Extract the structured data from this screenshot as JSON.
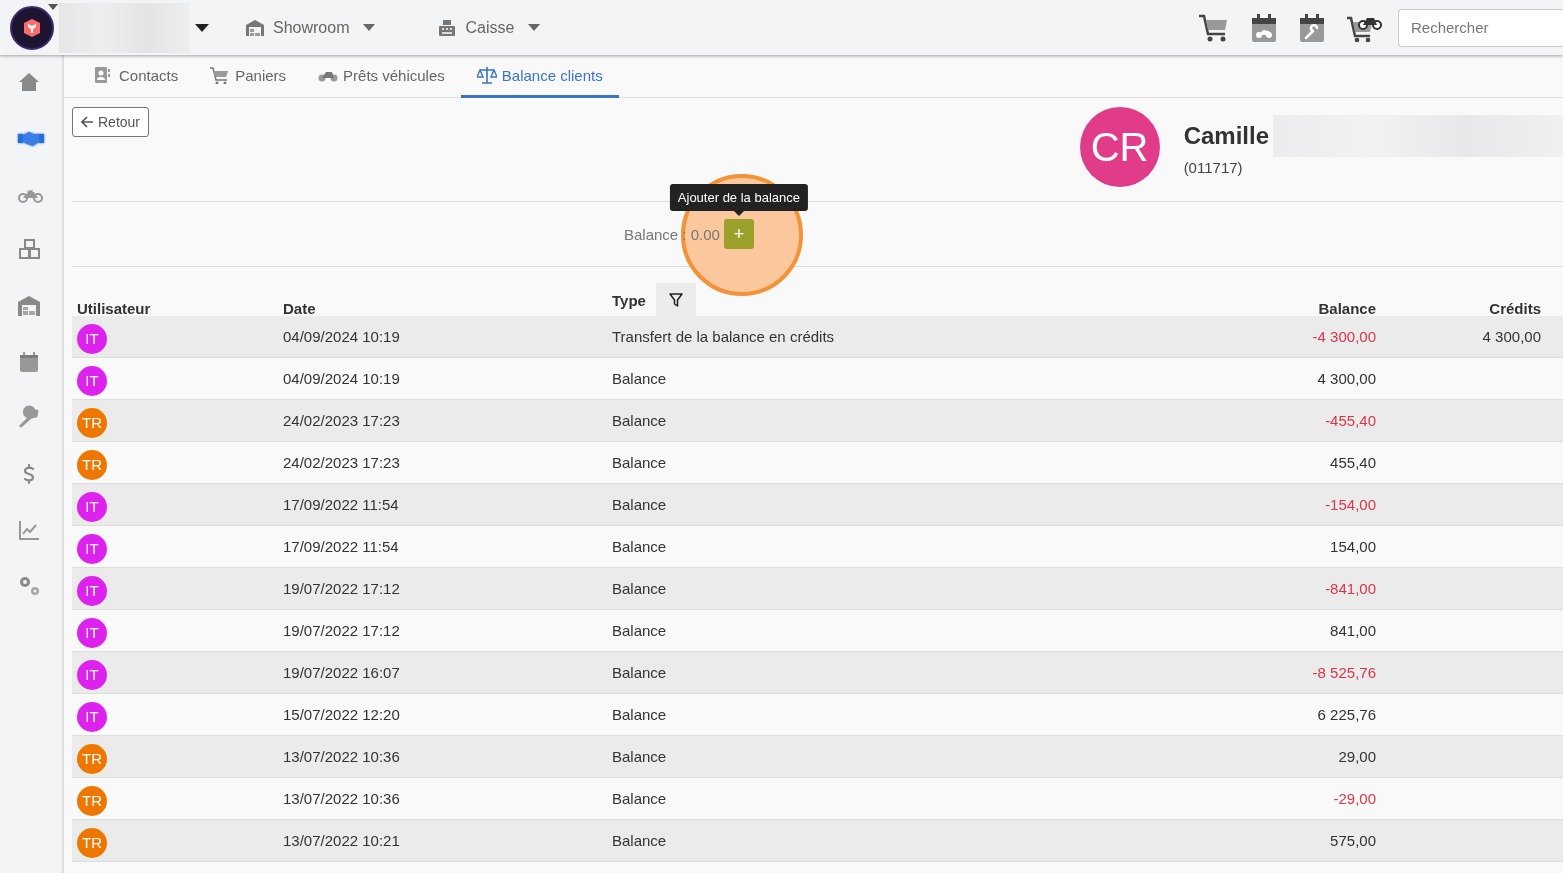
{
  "top_bar": {
    "menus": [
      {
        "label": "Showroom"
      },
      {
        "label": "Caisse"
      }
    ],
    "search": {
      "placeholder": "Rechercher"
    }
  },
  "sidebar": {
    "items": [
      {
        "selected": false
      },
      {
        "selected": true
      },
      {
        "selected": false
      },
      {
        "selected": false
      },
      {
        "selected": false
      },
      {
        "selected": false
      },
      {
        "selected": false
      },
      {
        "selected": false
      },
      {
        "selected": false
      },
      {
        "selected": false
      }
    ]
  },
  "tabs": [
    {
      "label": "Contacts",
      "selected": false
    },
    {
      "label": "Paniers",
      "selected": false
    },
    {
      "label": "Prêts véhicules",
      "selected": false
    },
    {
      "label": "Balance clients",
      "selected": true
    }
  ],
  "back_button": "Retour",
  "client": {
    "initials": "CR",
    "name": "Camille",
    "number": "(011717)"
  },
  "balance": {
    "label": "Balance : 0.00",
    "add_button": "+",
    "tooltip": "Ajouter de la balance"
  },
  "table": {
    "columns": [
      "Utilisateur",
      "Date",
      "Type",
      "Balance",
      "Crédits"
    ],
    "rows": [
      {
        "user": "IT",
        "color": "#dd22ee",
        "date": "04/09/2024 10:19",
        "type": "Transfert de la balance en crédits",
        "balance": "-4 300,00",
        "negative": true,
        "credits": "4 300,00"
      },
      {
        "user": "IT",
        "color": "#dd22ee",
        "date": "04/09/2024 10:19",
        "type": "Balance",
        "balance": "4 300,00",
        "negative": false
      },
      {
        "user": "TR",
        "color": "#ee7700",
        "date": "24/02/2023 17:23",
        "type": "Balance",
        "balance": "-455,40",
        "negative": true
      },
      {
        "user": "TR",
        "color": "#ee7700",
        "date": "24/02/2023 17:23",
        "type": "Balance",
        "balance": "455,40",
        "negative": false
      },
      {
        "user": "IT",
        "color": "#dd22ee",
        "date": "17/09/2022 11:54",
        "type": "Balance",
        "balance": "-154,00",
        "negative": true
      },
      {
        "user": "IT",
        "color": "#dd22ee",
        "date": "17/09/2022 11:54",
        "type": "Balance",
        "balance": "154,00",
        "negative": false
      },
      {
        "user": "IT",
        "color": "#dd22ee",
        "date": "19/07/2022 17:12",
        "type": "Balance",
        "balance": "-841,00",
        "negative": true
      },
      {
        "user": "IT",
        "color": "#dd22ee",
        "date": "19/07/2022 17:12",
        "type": "Balance",
        "balance": "841,00",
        "negative": false
      },
      {
        "user": "IT",
        "color": "#dd22ee",
        "date": "19/07/2022 16:07",
        "type": "Balance",
        "balance": "-8 525,76",
        "negative": true
      },
      {
        "user": "IT",
        "color": "#dd22ee",
        "date": "15/07/2022 12:20",
        "type": "Balance",
        "balance": "6 225,76",
        "negative": false
      },
      {
        "user": "TR",
        "color": "#ee7700",
        "date": "13/07/2022 10:36",
        "type": "Balance",
        "balance": "29,00",
        "negative": false
      },
      {
        "user": "TR",
        "color": "#ee7700",
        "date": "13/07/2022 10:36",
        "type": "Balance",
        "balance": "-29,00",
        "negative": true
      },
      {
        "user": "TR",
        "color": "#ee7700",
        "date": "13/07/2022 10:21",
        "type": "Balance",
        "balance": "575,00",
        "negative": false
      }
    ]
  }
}
